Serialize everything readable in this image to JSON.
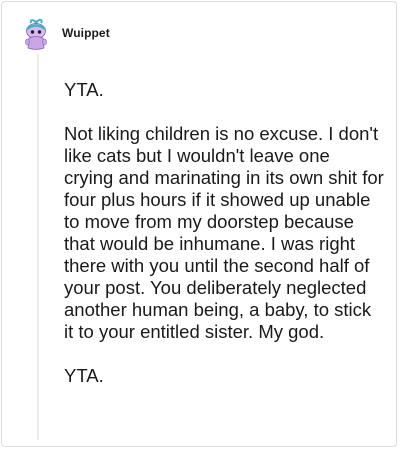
{
  "comment": {
    "author": "Wuippet",
    "avatar_icon": "snoo-avatar-icon",
    "paragraphs": [
      "YTA.",
      "Not liking children is no excuse. I don't like cats but I wouldn't leave one crying and marinating in its own shit for four plus hours if it showed up unable to move from my doorstep because that would be inhumane. I was right there with you until the second half of your post. You deliberately neglected another human being, a baby, to stick it to your entitled sister. My god.",
      "YTA."
    ]
  },
  "colors": {
    "text": "#1a1a1b",
    "border": "#dcdcdc",
    "avatar_body": "#c9a6e6",
    "avatar_hair": "#3db6c4",
    "avatar_eye": "#1c1c1c"
  }
}
